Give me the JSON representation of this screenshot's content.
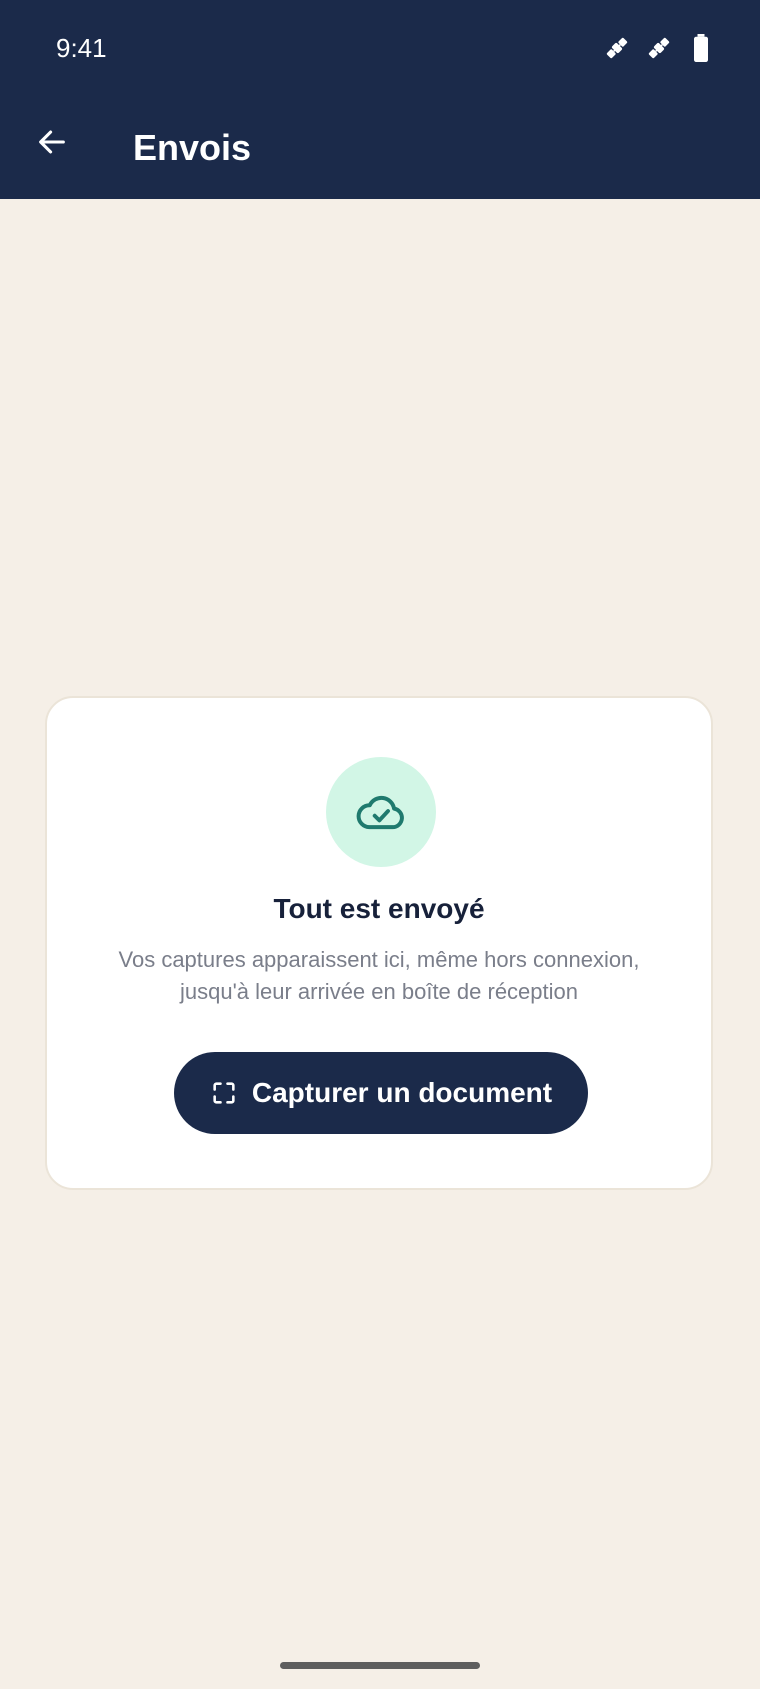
{
  "status_bar": {
    "time": "9:41",
    "icons": [
      "satellite-icon",
      "satellite-icon",
      "battery-icon"
    ]
  },
  "header": {
    "title": "Envois",
    "back_icon": "arrow-left-icon"
  },
  "empty_state": {
    "icon": "cloud-check-icon",
    "title": "Tout est envoyé",
    "description": "Vos captures apparaissent ici, même hors connexion, jusqu'à leur arrivée en boîte de réception",
    "button": {
      "icon": "scan-frame-icon",
      "label": "Capturer un document"
    }
  },
  "colors": {
    "header_bg": "#1b2a4a",
    "page_bg": "#f5efe7",
    "card_bg": "#ffffff",
    "badge_bg": "#d2f6e6",
    "badge_icon": "#1f7a6e",
    "title_text": "#17213a",
    "muted_text": "#7a7e8a"
  }
}
